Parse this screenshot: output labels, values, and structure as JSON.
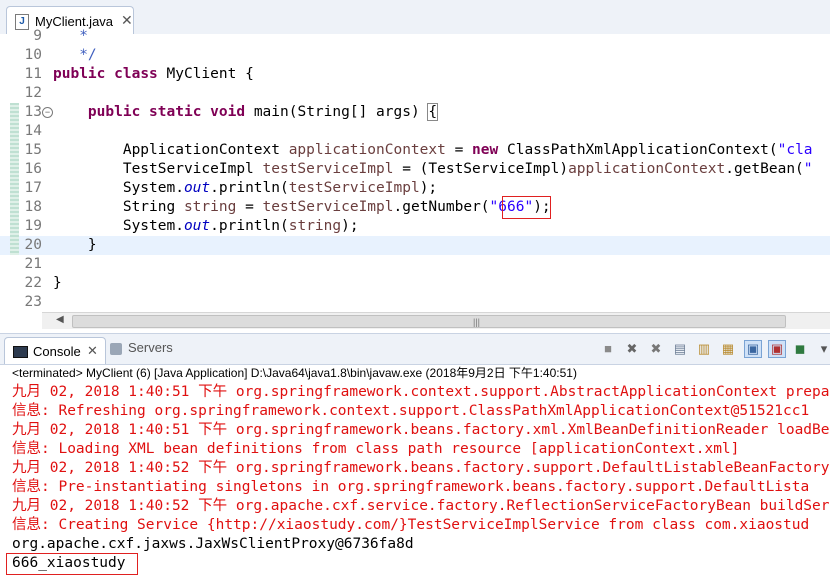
{
  "editor": {
    "tab_title": "MyClient.java",
    "tab_icon": "java-file-icon",
    "lines": [
      {
        "num": "9",
        "segments": [
          {
            "t": "   *",
            "c": "cm"
          }
        ]
      },
      {
        "num": "10",
        "segments": [
          {
            "t": "   */",
            "c": "cm"
          }
        ]
      },
      {
        "num": "11",
        "segments": [
          {
            "t": "public",
            "c": "kw"
          },
          {
            "t": " "
          },
          {
            "t": "class",
            "c": "kw"
          },
          {
            "t": " MyClient {"
          }
        ]
      },
      {
        "num": "12",
        "segments": []
      },
      {
        "num": "13",
        "segments": [
          {
            "t": "    "
          },
          {
            "t": "public",
            "c": "kw"
          },
          {
            "t": " "
          },
          {
            "t": "static",
            "c": "kw"
          },
          {
            "t": " "
          },
          {
            "t": "void",
            "c": "kw"
          },
          {
            "t": " main(String[] args) "
          },
          {
            "t": "{",
            "c": "brace"
          }
        ]
      },
      {
        "num": "14",
        "segments": []
      },
      {
        "num": "15",
        "segments": [
          {
            "t": "        ApplicationContext "
          },
          {
            "t": "applicationContext",
            "c": "var"
          },
          {
            "t": " = "
          },
          {
            "t": "new",
            "c": "kw"
          },
          {
            "t": " ClassPathXmlApplicationContext("
          },
          {
            "t": "\"cla",
            "c": "str"
          }
        ]
      },
      {
        "num": "16",
        "segments": [
          {
            "t": "        TestServiceImpl "
          },
          {
            "t": "testServiceImpl",
            "c": "var"
          },
          {
            "t": " = (TestServiceImpl)"
          },
          {
            "t": "applicationContext",
            "c": "var"
          },
          {
            "t": ".getBean("
          },
          {
            "t": "\"",
            "c": "str"
          }
        ]
      },
      {
        "num": "17",
        "segments": [
          {
            "t": "        System."
          },
          {
            "t": "out",
            "c": "fld"
          },
          {
            "t": ".println("
          },
          {
            "t": "testServiceImpl",
            "c": "var"
          },
          {
            "t": ");"
          }
        ]
      },
      {
        "num": "18",
        "segments": [
          {
            "t": "        String "
          },
          {
            "t": "string",
            "c": "var"
          },
          {
            "t": " = "
          },
          {
            "t": "testServiceImpl",
            "c": "var"
          },
          {
            "t": ".getNumber("
          },
          {
            "t": "\"666\"",
            "c": "str"
          },
          {
            "t": ");"
          }
        ]
      },
      {
        "num": "19",
        "segments": [
          {
            "t": "        System."
          },
          {
            "t": "out",
            "c": "fld"
          },
          {
            "t": ".println("
          },
          {
            "t": "string",
            "c": "var"
          },
          {
            "t": ");"
          }
        ]
      },
      {
        "num": "20",
        "segments": [
          {
            "t": "    }"
          }
        ]
      },
      {
        "num": "21",
        "segments": []
      },
      {
        "num": "22",
        "segments": [
          {
            "t": "}"
          }
        ]
      },
      {
        "num": "23",
        "segments": []
      }
    ]
  },
  "console": {
    "tab_label": "Console",
    "servers_label": "Servers",
    "header": "<terminated> MyClient (6) [Java Application] D:\\Java64\\java1.8\\bin\\javaw.exe (2018年9月2日 下午1:40:51)",
    "lines": [
      {
        "text": "九月 02, 2018 1:40:51 下午 org.springframework.context.support.AbstractApplicationContext prepa",
        "type": "err"
      },
      {
        "text": "信息: Refreshing org.springframework.context.support.ClassPathXmlApplicationContext@51521cc1",
        "type": "err"
      },
      {
        "text": "九月 02, 2018 1:40:51 下午 org.springframework.beans.factory.xml.XmlBeanDefinitionReader loadBe",
        "type": "err"
      },
      {
        "text": "信息: Loading XML bean definitions from class path resource [applicationContext.xml]",
        "type": "err"
      },
      {
        "text": "九月 02, 2018 1:40:52 下午 org.springframework.beans.factory.support.DefaultListableBeanFactory",
        "type": "err"
      },
      {
        "text": "信息: Pre-instantiating singletons in org.springframework.beans.factory.support.DefaultLista",
        "type": "err"
      },
      {
        "text": "九月 02, 2018 1:40:52 下午 org.apache.cxf.service.factory.ReflectionServiceFactoryBean buildSer",
        "type": "err"
      },
      {
        "text": "信息: Creating Service {http://xiaostudy.com/}TestServiceImplService from class com.xiaostud",
        "type": "err"
      },
      {
        "text": "org.apache.cxf.jaxws.JaxWsClientProxy@6736fa8d",
        "type": "out"
      },
      {
        "text": "666_xiaostudy",
        "type": "out"
      }
    ]
  },
  "toolbar": {
    "buttons": [
      {
        "name": "terminate-icon",
        "glyph": "■",
        "color": "#8a8a8a"
      },
      {
        "name": "remove-launch-icon",
        "glyph": "✖",
        "color": "#666666"
      },
      {
        "name": "remove-all-launches-icon",
        "glyph": "✖",
        "color": "#777777"
      },
      {
        "name": "clear-console-icon",
        "glyph": "▤",
        "color": "#6b7c93"
      },
      {
        "name": "scroll-lock-icon",
        "glyph": "▥",
        "color": "#b88a2c"
      },
      {
        "name": "word-wrap-icon",
        "glyph": "▦",
        "color": "#b88a2c"
      },
      {
        "name": "show-on-stdout-icon",
        "glyph": "▣",
        "color": "#3a66a0",
        "active": true
      },
      {
        "name": "show-on-stderr-icon",
        "glyph": "▣",
        "color": "#b03030",
        "active": true
      },
      {
        "name": "pin-console-icon",
        "glyph": "◼",
        "color": "#2f7a40"
      },
      {
        "name": "open-console-icon",
        "glyph": "▾",
        "color": "#555555"
      }
    ]
  },
  "colors": {
    "error": "#e01010",
    "highlight_box": "#e02020"
  }
}
